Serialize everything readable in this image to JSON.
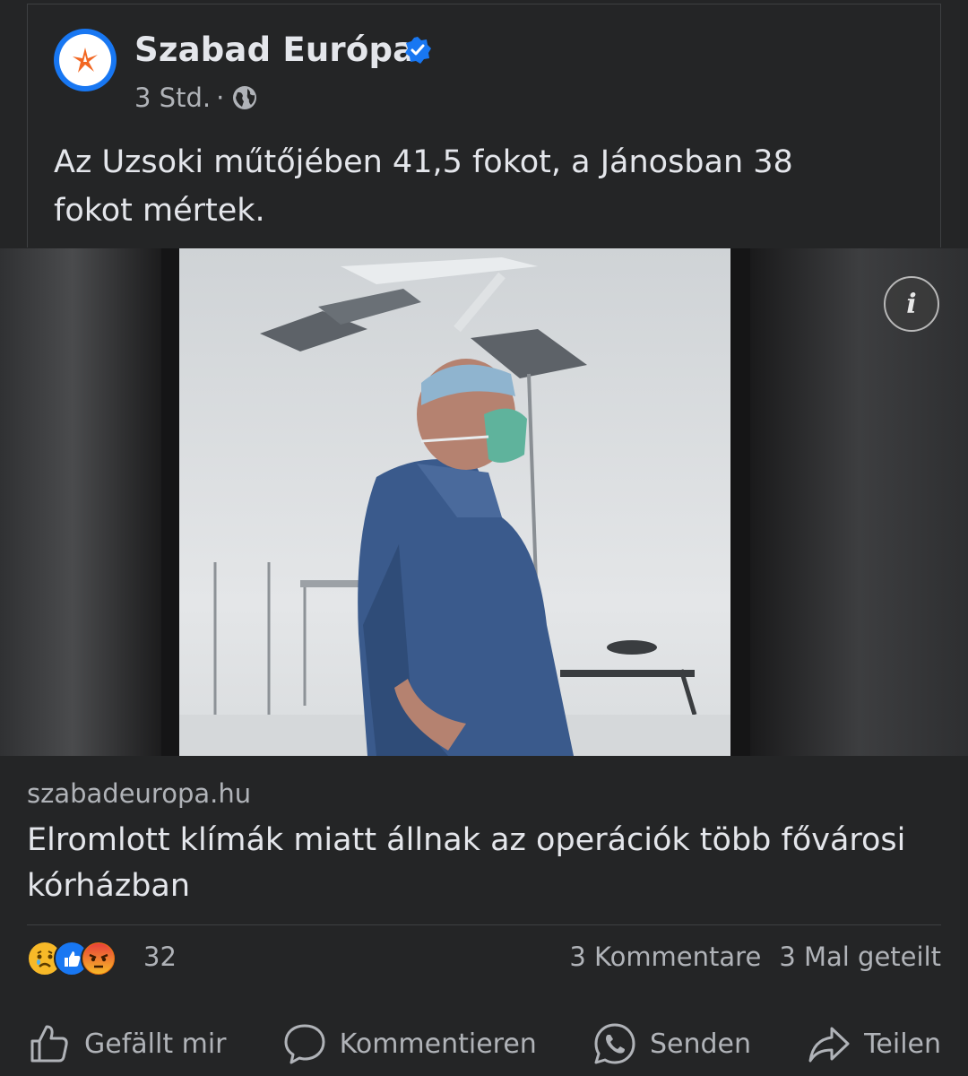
{
  "post": {
    "page_name": "Szabad Európa",
    "time": "3 Std.",
    "separator": "·",
    "text": "Az Uzsoki műtőjében 41,5 fokot, a Jánosban 38 fokot mértek."
  },
  "link": {
    "domain": "szabadeuropa.hu",
    "title": "Elromlott klímák miatt állnak az operációk több fővárosi kórházban"
  },
  "stats": {
    "reactions_count": "32",
    "comments": "3 Kommentare",
    "shares": "3 Mal geteilt"
  },
  "actions": {
    "like": "Gefällt mir",
    "comment": "Kommentieren",
    "send": "Senden",
    "share": "Teilen"
  },
  "colors": {
    "background": "#242526",
    "accent": "#1877f2",
    "text_primary": "#e4e6eb",
    "text_secondary": "#b0b3b8"
  },
  "icons": {
    "avatar": "rferl-logo-icon",
    "verified": "verified-badge-icon",
    "audience": "globe-icon",
    "info": "info-icon",
    "reactions": [
      "sad-reaction-icon",
      "like-reaction-icon",
      "angry-reaction-icon"
    ],
    "like": "thumbs-up-icon",
    "comment": "comment-bubble-icon",
    "send": "whatsapp-icon",
    "share": "share-arrow-icon"
  }
}
